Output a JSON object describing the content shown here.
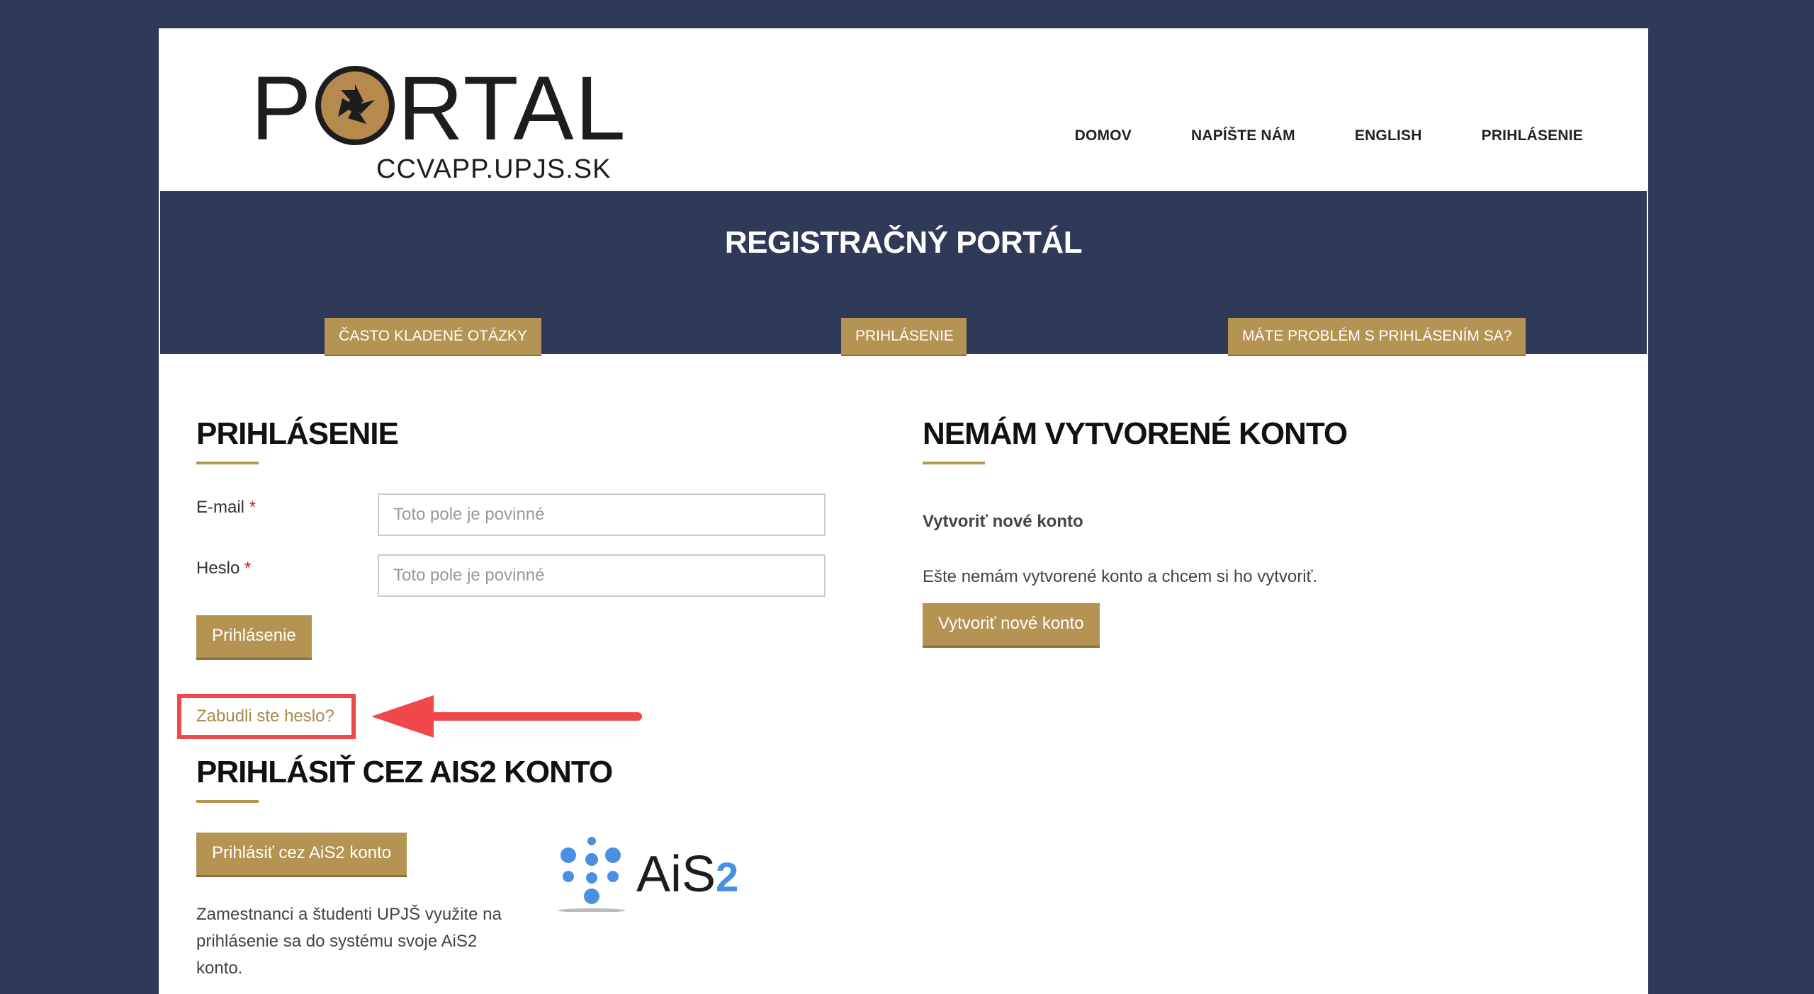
{
  "logo": {
    "word_left": "P",
    "word_right": "RTAL",
    "subtitle": "CCVAPP.UPJS.SK"
  },
  "nav": {
    "items": [
      "DOMOV",
      "NAPÍŠTE NÁM",
      "ENGLISH",
      "PRIHLÁSENIE"
    ]
  },
  "banner": {
    "title": "REGISTRAČNÝ PORTÁL",
    "buttons": [
      "ČASTO KLADENÉ OTÁZKY",
      "PRIHLÁSENIE",
      "MÁTE PROBLÉM S PRIHLÁSENÍM SA?"
    ]
  },
  "login": {
    "heading": "PRIHLÁSENIE",
    "email_label": "E-mail",
    "password_label": "Heslo",
    "required_mark": "*",
    "email_placeholder": "Toto pole je povinné",
    "password_placeholder": "Toto pole je povinné",
    "submit_label": "Prihlásenie",
    "forgot_label": "Zabudli ste heslo?"
  },
  "ais": {
    "heading": "PRIHLÁSIŤ CEZ AIS2 KONTO",
    "button_label": "Prihlásiť cez AiS2 konto",
    "description": "Zamestnanci a študenti UPJŠ využite na prihlásenie sa do systému svoje AiS2 konto.",
    "logo_text": "AiS",
    "logo_suffix": "2"
  },
  "register": {
    "heading": "NEMÁM VYTVORENÉ KONTO",
    "subheading": "Vytvoriť nové konto",
    "text": "Ešte nemám vytvorené konto a chcem si ho vytvoriť.",
    "button_label": "Vytvoriť nové konto"
  },
  "colors": {
    "background": "#2f3a58",
    "accent": "#b59352",
    "highlight": "#f0474a"
  }
}
